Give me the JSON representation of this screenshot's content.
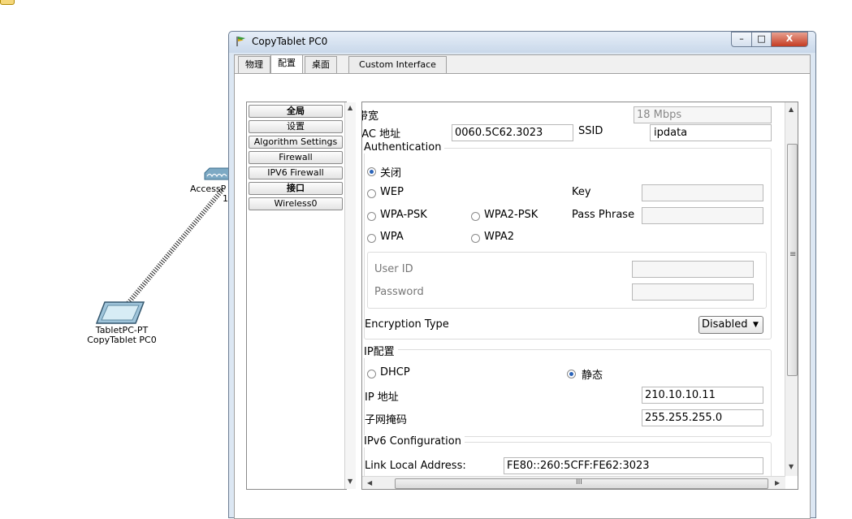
{
  "canvas": {
    "access_point_label": "AccessP",
    "access_point_num": "1",
    "tablet_model": "TabletPC-PT",
    "tablet_name": "CopyTablet PC0"
  },
  "window": {
    "title": "CopyTablet PC0",
    "min_label": "–",
    "max_label": "□",
    "close_label": "X"
  },
  "tabs": [
    "物理",
    "配置",
    "桌面",
    "Custom Interface"
  ],
  "left_list": {
    "items": [
      "全局",
      "设置",
      "Algorithm Settings",
      "Firewall",
      "IPV6 Firewall",
      "接口",
      "Wireless0"
    ]
  },
  "config": {
    "bandwidth_label": "带宽",
    "bandwidth_value": "18 Mbps",
    "mac_label": "MAC 地址",
    "mac_value": "0060.5C62.3023",
    "ssid_label": "SSID",
    "ssid_value": "ipdata",
    "auth_title": "Authentication",
    "auth_off": "关闭",
    "auth_wep": "WEP",
    "auth_wpa_psk": "WPA-PSK",
    "auth_wpa2_psk": "WPA2-PSK",
    "auth_wpa": "WPA",
    "auth_wpa2": "WPA2",
    "key_label": "Key",
    "key_value": "",
    "passphrase_label": "Pass Phrase",
    "passphrase_value": "",
    "user_id_label": "User ID",
    "user_id_value": "",
    "password_label": "Password",
    "password_value": "",
    "encryption_label": "Encryption Type",
    "encryption_value": "Disabled",
    "ip_config_title": "IP配置",
    "dhcp_label": "DHCP",
    "static_label": "静态",
    "ip_label": "IP 地址",
    "ip_value": "210.10.10.11",
    "mask_label": "子网掩码",
    "mask_value": "255.255.255.0",
    "ipv6_title": "IPv6 Configuration",
    "link_local_label": "Link Local Address:",
    "link_local_value": "FE80::260:5CFF:FE62:3023",
    "hscroll_grip": "III",
    "vscroll_grip": "≡"
  }
}
